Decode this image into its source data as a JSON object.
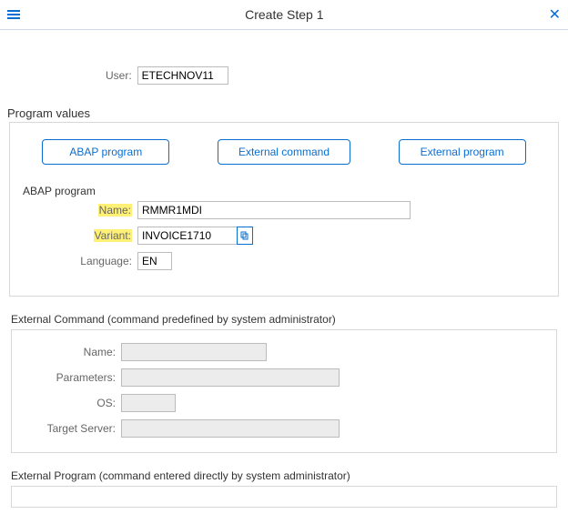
{
  "header": {
    "title": "Create Step  1"
  },
  "user": {
    "label": "User:",
    "value": "ETECHNOV11"
  },
  "programValues": {
    "title": "Program values",
    "tabs": {
      "abap": "ABAP program",
      "extCmd": "External command",
      "extProg": "External program"
    }
  },
  "abap": {
    "title": "ABAP program",
    "nameLabel": "Name:",
    "nameValue": "RMMR1MDI",
    "variantLabel": "Variant:",
    "variantValue": "INVOICE1710",
    "languageLabel": "Language:",
    "languageValue": "EN"
  },
  "extCmd": {
    "title": "External Command (command predefined by system administrator)",
    "nameLabel": "Name:",
    "nameValue": "",
    "paramsLabel": "Parameters:",
    "paramsValue": "",
    "osLabel": "OS:",
    "osValue": "",
    "targetLabel": "Target Server:",
    "targetValue": ""
  },
  "extProg": {
    "title": "External Program (command entered directly by system administrator)"
  },
  "icons": {
    "menu": "menu-icon",
    "close": "close-icon",
    "f4": "value-help-icon"
  }
}
